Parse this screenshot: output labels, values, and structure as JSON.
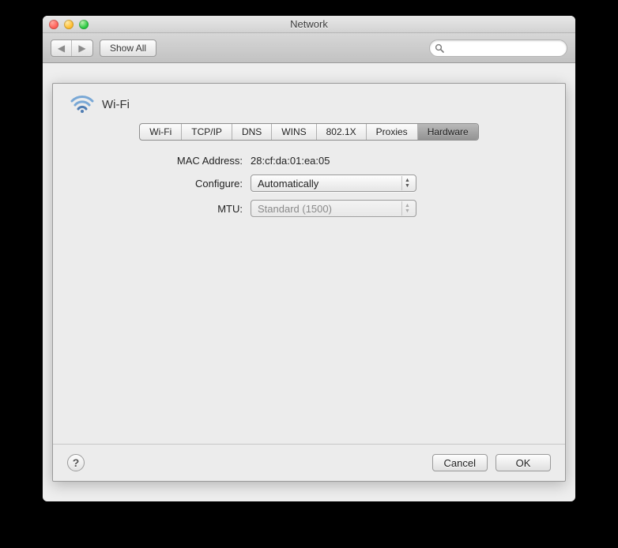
{
  "window": {
    "title": "Network"
  },
  "toolbar": {
    "show_all_label": "Show All",
    "search_placeholder": ""
  },
  "sheet": {
    "connection_name": "Wi-Fi",
    "tabs": [
      {
        "label": "Wi-Fi"
      },
      {
        "label": "TCP/IP"
      },
      {
        "label": "DNS"
      },
      {
        "label": "WINS"
      },
      {
        "label": "802.1X"
      },
      {
        "label": "Proxies"
      },
      {
        "label": "Hardware"
      }
    ],
    "active_tab_index": 6,
    "fields": {
      "mac_label": "MAC Address:",
      "mac_value": "28:cf:da:01:ea:05",
      "configure_label": "Configure:",
      "configure_value": "Automatically",
      "mtu_label": "MTU:",
      "mtu_value": "Standard  (1500)"
    },
    "buttons": {
      "help_label": "?",
      "cancel_label": "Cancel",
      "ok_label": "OK"
    }
  }
}
